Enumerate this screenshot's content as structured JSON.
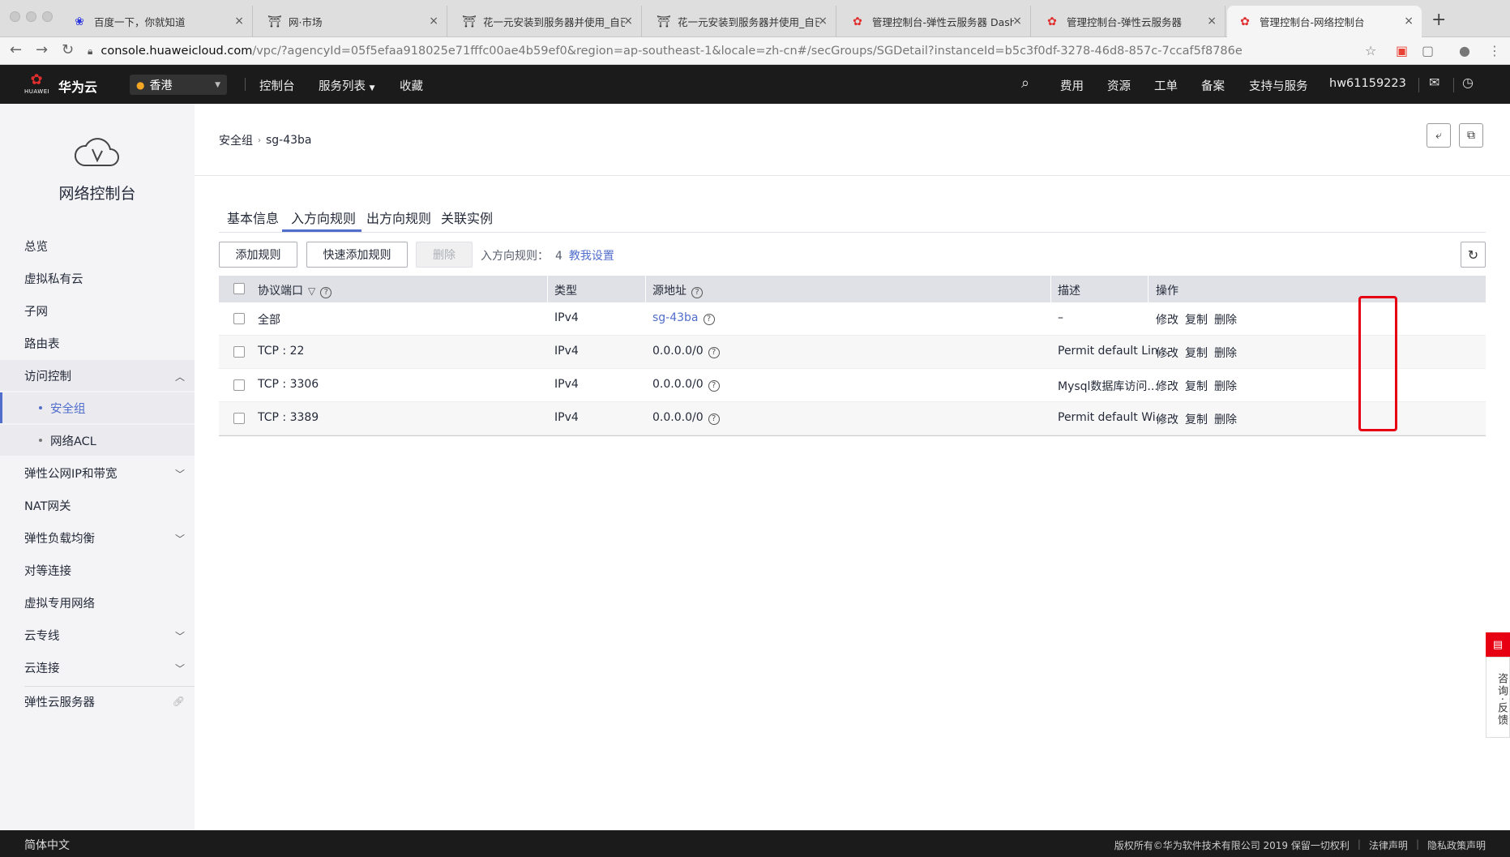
{
  "browser": {
    "tabs": [
      {
        "title": "百度一下，你就知道",
        "icon": "baidu-paw-icon",
        "icon_color": "#2932e1"
      },
      {
        "title": "网·市场",
        "icon": "market-icon",
        "icon_color": "#555555"
      },
      {
        "title": "花一元安装到服务器并使用_自已",
        "icon": "market-icon",
        "icon_color": "#555555"
      },
      {
        "title": "花一元安装到服务器并使用_自已",
        "icon": "market-icon",
        "icon_color": "#555555"
      },
      {
        "title": "管理控制台-弹性云服务器 Dashb",
        "icon": "huawei-logo-icon",
        "icon_color": "#e02d2d"
      },
      {
        "title": "管理控制台-弹性云服务器",
        "icon": "huawei-logo-icon",
        "icon_color": "#e02d2d"
      },
      {
        "title": "管理控制台-网络控制台",
        "icon": "huawei-logo-icon",
        "icon_color": "#e02d2d",
        "active": true
      }
    ],
    "url_host": "console.huaweicloud.com",
    "url_rest": "/vpc/?agencyId=05f5efaa918025e71fffc00ae4b59ef0&region=ap-southeast-1&locale=zh-cn#/secGroups/SGDetail?instanceId=b5c3f0df-3278-46d8-857c-7ccaf5f8786e"
  },
  "topnav": {
    "logo_text": "HUAWEI",
    "brand": "华为云",
    "region": "香港",
    "menu": [
      "控制台",
      "服务列表",
      "收藏"
    ],
    "right": [
      "费用",
      "资源",
      "工单",
      "备案",
      "支持与服务"
    ],
    "user": "hw61159223"
  },
  "sidebar": {
    "title": "网络控制台",
    "items": [
      {
        "label": "总览"
      },
      {
        "label": "虚拟私有云"
      },
      {
        "label": "子网"
      },
      {
        "label": "路由表"
      },
      {
        "label": "访问控制"
      },
      {
        "label": "安全组"
      },
      {
        "label": "网络ACL"
      },
      {
        "label": "弹性公网IP和带宽"
      },
      {
        "label": "NAT网关"
      },
      {
        "label": "弹性负载均衡"
      },
      {
        "label": "对等连接"
      },
      {
        "label": "虚拟专用网络"
      },
      {
        "label": "云专线"
      },
      {
        "label": "云连接"
      },
      {
        "label": "弹性云服务器"
      }
    ]
  },
  "breadcrumb": {
    "parent": "安全组",
    "current": "sg-43ba"
  },
  "tabs": [
    "基本信息",
    "入方向规则",
    "出方向规则",
    "关联实例"
  ],
  "toolbar": {
    "add": "添加规则",
    "quick_add": "快速添加规则",
    "delete": "删除",
    "count_label": "入方向规则：",
    "count": "4",
    "help_link": "教我设置"
  },
  "table": {
    "headers": [
      "协议端口",
      "类型",
      "源地址",
      "描述",
      "操作"
    ],
    "rows": [
      {
        "port": "全部",
        "type": "IPv4",
        "source": "sg-43ba",
        "source_link": true,
        "desc": "–"
      },
      {
        "port": "TCP : 22",
        "type": "IPv4",
        "source": "0.0.0.0/0",
        "desc": "Permit default Lin..."
      },
      {
        "port": "TCP : 3306",
        "type": "IPv4",
        "source": "0.0.0.0/0",
        "desc": "Mysql数据库访问..."
      },
      {
        "port": "TCP : 3389",
        "type": "IPv4",
        "source": "0.0.0.0/0",
        "desc": "Permit default Wi..."
      }
    ],
    "actions": [
      "修改",
      "复制",
      "删除"
    ]
  },
  "feedback": "咨询·反馈",
  "footer": {
    "lang": "简体中文",
    "copyright": "版权所有©华为软件技术有限公司 2019 保留一切权利",
    "legal": "法律声明",
    "privacy": "隐私政策声明"
  },
  "colors": {
    "accent": "#526ecc",
    "highlight": "#e60012",
    "nav_bg": "#1b1b1b"
  }
}
